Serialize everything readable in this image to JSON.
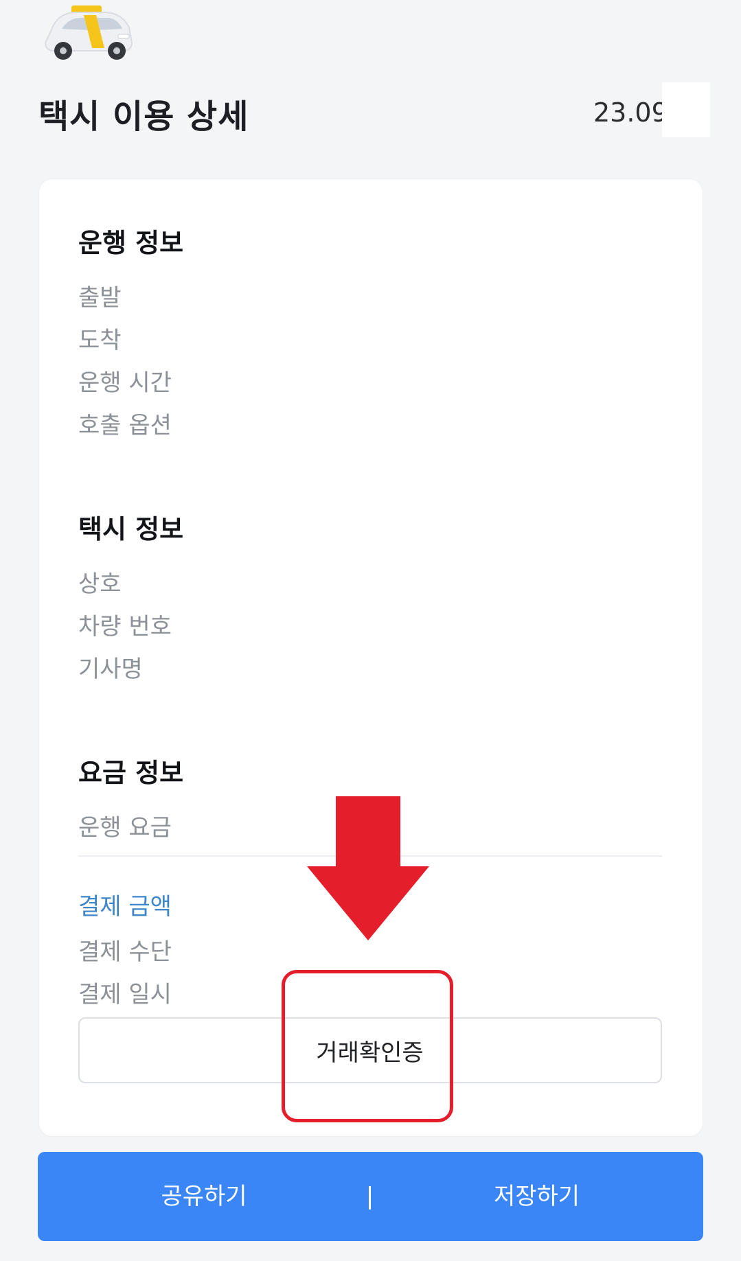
{
  "header": {
    "title": "택시 이용 상세",
    "date": "23.09",
    "icon": "taxi-icon"
  },
  "sections": {
    "trip": {
      "title": "운행 정보",
      "labels": [
        "출발",
        "도착",
        "운행 시간",
        "호출 옵션"
      ]
    },
    "taxi": {
      "title": "택시 정보",
      "labels": [
        "상호",
        "차량 번호",
        "기사명"
      ]
    },
    "fare": {
      "title": "요금 정보",
      "fare_label": "운행 요금",
      "payment_amount_label": "결제 금액",
      "payment_method_label": "결제 수단",
      "payment_date_label": "결제 일시"
    }
  },
  "receipt_button": {
    "label": "거래확인증"
  },
  "bottom_bar": {
    "share_label": "공유하기",
    "separator": "|",
    "save_label": "저장하기"
  },
  "colors": {
    "background": "#f4f5f7",
    "accent_blue": "#3b86f7",
    "payment_amount_label": "#3d86c9",
    "annotation_red": "#e41e2b"
  }
}
